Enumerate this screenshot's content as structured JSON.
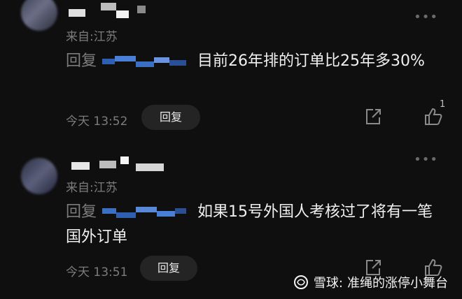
{
  "comments": [
    {
      "from": "来自:江苏",
      "reply_prefix": "回复",
      "text": "目前26年排的订单比25年多30%",
      "time": "今天 13:52",
      "reply_button": "回复",
      "likes": "1"
    },
    {
      "from": "来自:江苏",
      "reply_prefix": "回复",
      "text": "如果15号外国人考核过了将有一笔国外订单",
      "time": "今天 13:51",
      "reply_button": "回复",
      "likes": ""
    }
  ],
  "more_icon": "ellipsis-icon",
  "share_icon": "share-icon",
  "like_icon": "thumbs-up-icon",
  "watermark": {
    "brand": "雪球:",
    "author": "准绳的涨停小舞台"
  },
  "colors": {
    "background": "#0f0f0f",
    "text": "#f0f0f0",
    "muted": "#7c7c7c",
    "button": "#242424",
    "mosaic_blue": "#3b6fc4"
  }
}
